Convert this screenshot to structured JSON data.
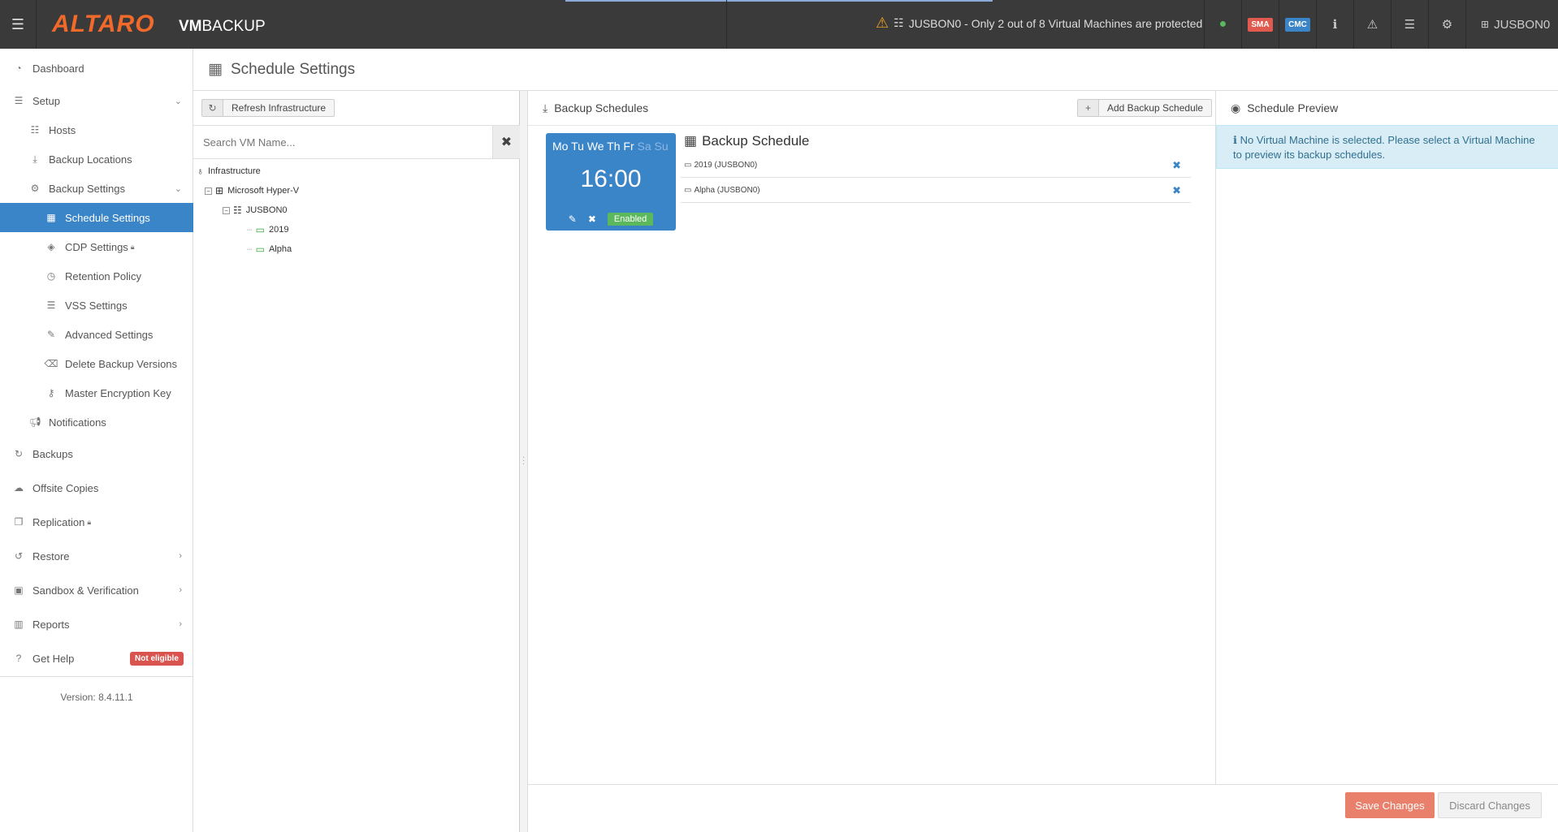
{
  "topbar": {
    "brand": "ALTARO",
    "product_vm": "VM",
    "product_backup": "BACKUP",
    "alert_text": "JUSBON0 - Only 2 out of 8 Virtual Machines are protected",
    "sma_label": "SMA",
    "cmc_label": "CMC",
    "sma_color": "#e05a4f",
    "cmc_color": "#3a84c8",
    "user": "JUSBON0"
  },
  "sidebar": {
    "dashboard": "Dashboard",
    "setup": "Setup",
    "hosts": "Hosts",
    "backup_locations": "Backup Locations",
    "backup_settings": "Backup Settings",
    "schedule_settings": "Schedule Settings",
    "cdp_settings": "CDP Settings",
    "retention_policy": "Retention Policy",
    "vss_settings": "VSS Settings",
    "advanced_settings": "Advanced Settings",
    "delete_backup_versions": "Delete Backup Versions",
    "master_encryption_key": "Master Encryption Key",
    "notifications": "Notifications",
    "backups": "Backups",
    "offsite_copies": "Offsite Copies",
    "replication": "Replication",
    "restore": "Restore",
    "sandbox": "Sandbox & Verification",
    "reports": "Reports",
    "get_help": "Get Help",
    "not_eligible": "Not eligible",
    "version": "Version: 8.4.11.1",
    "active_color": "#3a84c8"
  },
  "page": {
    "title": "Schedule Settings"
  },
  "infra": {
    "refresh_label": "Refresh Infrastructure",
    "search_placeholder": "Search VM Name...",
    "tree_root": "Infrastructure",
    "tree_hyperv": "Microsoft Hyper-V",
    "tree_host": "JUSBON0",
    "tree_vm1": "2019",
    "tree_vm2": "Alpha"
  },
  "schedules": {
    "header": "Backup Schedules",
    "add_label": "Add Backup Schedule",
    "days_on": "Mo Tu We Th Fr",
    "days_off": "Sa Su",
    "time": "16:00",
    "status": "Enabled",
    "title": "Backup Schedule",
    "vms": [
      {
        "name": "2019 (JUSBON0)"
      },
      {
        "name": "Alpha (JUSBON0)"
      }
    ]
  },
  "preview": {
    "header": "Schedule Preview",
    "info": "No Virtual Machine is selected. Please select a Virtual Machine to preview its backup schedules."
  },
  "footer": {
    "save": "Save Changes",
    "discard": "Discard Changes"
  }
}
